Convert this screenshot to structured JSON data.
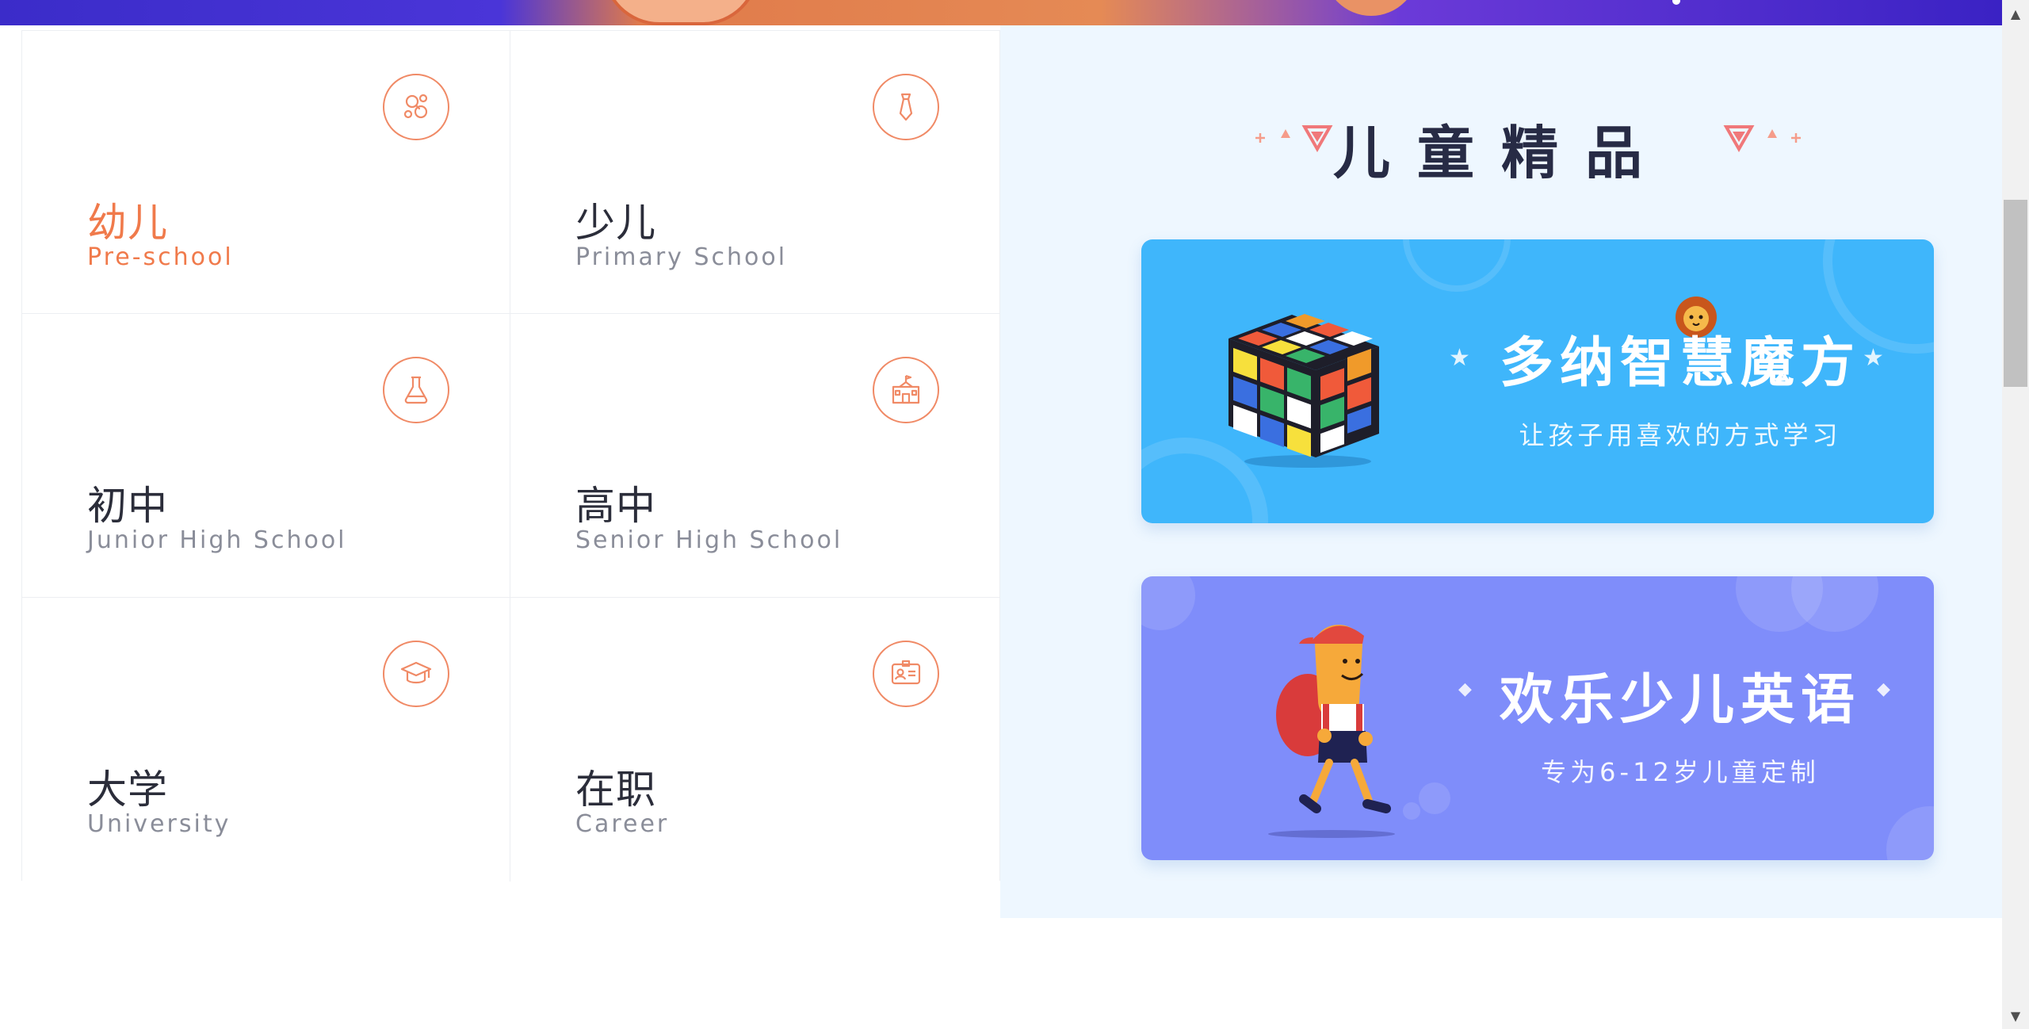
{
  "grades": [
    {
      "cn": "幼儿",
      "en": "Pre-school",
      "icon": "pacifier-icon",
      "active": true
    },
    {
      "cn": "少儿",
      "en": "Primary School",
      "icon": "necktie-icon",
      "active": false
    },
    {
      "cn": "初中",
      "en": "Junior High School",
      "icon": "flask-icon",
      "active": false
    },
    {
      "cn": "高中",
      "en": "Senior High School",
      "icon": "school-building-icon",
      "active": false
    },
    {
      "cn": "大学",
      "en": "University",
      "icon": "graduation-cap-icon",
      "active": false
    },
    {
      "cn": "在职",
      "en": "Career",
      "icon": "id-card-icon",
      "active": false
    }
  ],
  "featured": {
    "title": "儿童精品",
    "cards": [
      {
        "title": "多纳智慧魔方",
        "subtitle": "让孩子用喜欢的方式学习",
        "icon": "rubiks-cube-icon"
      },
      {
        "title": "欢乐少儿英语",
        "subtitle": "专为6-12岁儿童定制",
        "icon": "walking-kid-icon"
      }
    ]
  },
  "colors": {
    "accent": "#f07a4b",
    "text_dark": "#2b2d3a",
    "text_muted": "#8a8d99",
    "panel_bg": "#eef7ff",
    "card_cube_bg": "#3fb6fb",
    "card_english_bg": "#7f8dfa"
  }
}
